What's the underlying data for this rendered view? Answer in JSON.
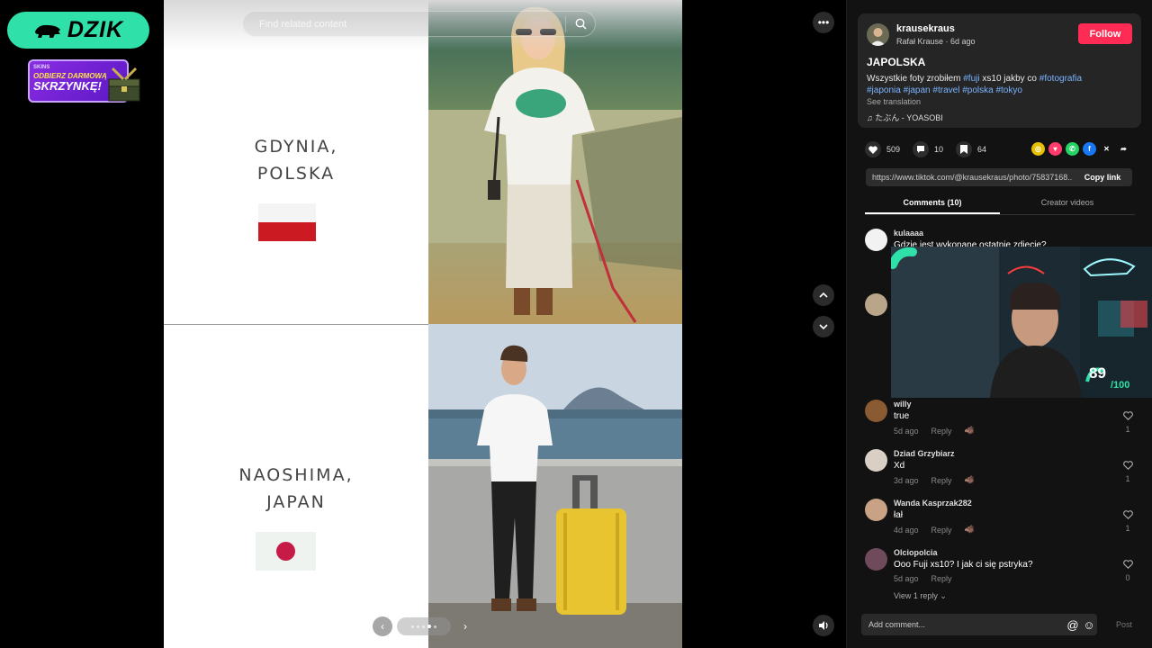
{
  "overlay": {
    "dzik_label": "DZIK",
    "promo_brand": "SKINS",
    "promo_line1": "ODBIERZ DARMOWĄ",
    "promo_line2": "SKRZYNKĘ!"
  },
  "post_image": {
    "search_placeholder": "Find related content",
    "place1_line1": "GDYNIA,",
    "place1_line2": "POLSKA",
    "place2_line1": "NAOSHIMA,",
    "place2_line2": "JAPAN"
  },
  "sidebar": {
    "username": "krausekraus",
    "subline": "Rafał Krause · 6d ago",
    "follow_label": "Follow",
    "title": "JAPOLSKA",
    "desc_plain1": "Wszystkie foty zrobiłem ",
    "desc_tag1": "#fuji",
    "desc_plain2": " xs10 jakby co ",
    "desc_tag2": "#fotografia",
    "desc_tags_line2": "#japonia #japan #travel #polska #tokyo",
    "see_translation": "See translation",
    "music": "♫  たぶん - YOASOBI",
    "likes": "509",
    "comments_count": "10",
    "saves": "64",
    "link": "https://www.tiktok.com/@krausekraus/photo/75837168...",
    "copy_label": "Copy link",
    "tab_comments": "Comments (10)",
    "tab_creator": "Creator videos",
    "composer_placeholder": "Add comment...",
    "post_label": "Post",
    "view_replies": "View 1 reply",
    "comments": [
      {
        "name": "kulaaaa",
        "text": "Gdzie jest wykonane ostatnie zdjecie?",
        "date": "",
        "likes": ""
      },
      {
        "name": "willy",
        "text": "true",
        "date": "5d ago",
        "likes": "1"
      },
      {
        "name": "Dziad Grzybiarz",
        "text": "Xd",
        "date": "3d ago",
        "likes": "1"
      },
      {
        "name": "Wanda Kasprzak282",
        "text": "łał",
        "date": "4d ago",
        "likes": "1"
      },
      {
        "name": "Olciopolcia",
        "text": "Ooo Fuji xs10? I jak ci się pstryka?",
        "date": "5d ago",
        "likes": "0"
      }
    ],
    "reply_label": "Reply"
  },
  "stream": {
    "score": "89",
    "score_max": "/100"
  },
  "colors": {
    "accent_green": "#2fe0a8",
    "follow_red": "#fe2c55",
    "hashtag_blue": "#7ab4ff"
  }
}
